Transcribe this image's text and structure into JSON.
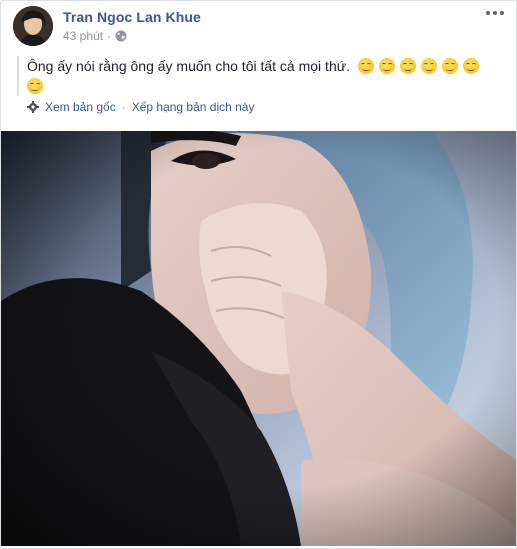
{
  "post": {
    "author": "Tran Ngoc Lan Khue",
    "time": "43 phút",
    "separator": "·",
    "privacy_icon": "globe-icon",
    "menu_icon": "more-options-icon",
    "text": "Ông ấy nói rằng ông ấy muốn cho tôi tất cả mọi thứ.",
    "emoji_count": 7,
    "emoji_name": "smiling-face-emoji"
  },
  "translation": {
    "icon": "gear-icon",
    "see_original": "Xem bản gốc",
    "separator": "·",
    "rate": "Xếp hạng bản dịch này"
  },
  "photo": {
    "icon": "photo-image"
  },
  "colors": {
    "link": "#385898",
    "meta": "#90949c",
    "text": "#1d2129",
    "border": "#dddfe2"
  }
}
